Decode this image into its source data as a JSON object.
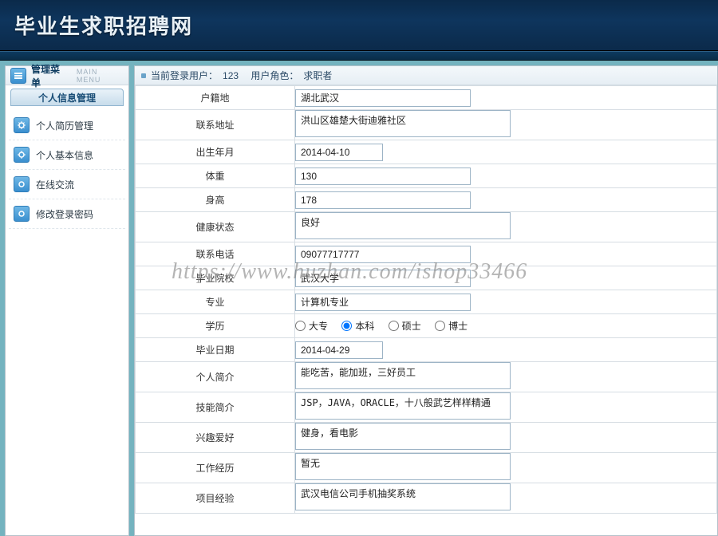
{
  "banner": {
    "title": "毕业生求职招聘网"
  },
  "sidebar": {
    "title": "管理菜单",
    "title_sub": "MAIN MENU",
    "group": "个人信息管理",
    "items": [
      {
        "label": "个人简历管理"
      },
      {
        "label": "个人基本信息"
      },
      {
        "label": "在线交流"
      },
      {
        "label": "修改登录密码"
      }
    ]
  },
  "crumb": {
    "prefix": "当前登录用户：",
    "user": "123",
    "role_prefix": "用户角色：",
    "role": "求职者"
  },
  "form": {
    "hukou": {
      "label": "户籍地",
      "value": "湖北武汉"
    },
    "address": {
      "label": "联系地址",
      "value": "洪山区雄楚大街迪雅社区"
    },
    "birth": {
      "label": "出生年月",
      "value": "2014-04-10"
    },
    "weight": {
      "label": "体重",
      "value": "130"
    },
    "height": {
      "label": "身高",
      "value": "178"
    },
    "health": {
      "label": "健康状态",
      "value": "良好"
    },
    "phone": {
      "label": "联系电话",
      "value": "09077717777"
    },
    "school": {
      "label": "毕业院校",
      "value": "武汉大学"
    },
    "major": {
      "label": "专业",
      "value": "计算机专业"
    },
    "degree": {
      "label": "学历",
      "options": [
        "大专",
        "本科",
        "硕士",
        "博士"
      ],
      "selected": "本科"
    },
    "grad_date": {
      "label": "毕业日期",
      "value": "2014-04-29"
    },
    "profile": {
      "label": "个人简介",
      "value": "能吃苦，能加班，三好员工"
    },
    "skills": {
      "label": "技能简介",
      "value": "JSP，JAVA，ORACLE，十八般武艺样样精通"
    },
    "hobby": {
      "label": "兴趣爱好",
      "value": "健身，看电影"
    },
    "work_exp": {
      "label": "工作经历",
      "value": "暂无"
    },
    "proj_exp": {
      "label": "项目经验",
      "value": "武汉电信公司手机抽奖系统"
    }
  },
  "watermark": "https://www.huzhan.com/ishop33466"
}
